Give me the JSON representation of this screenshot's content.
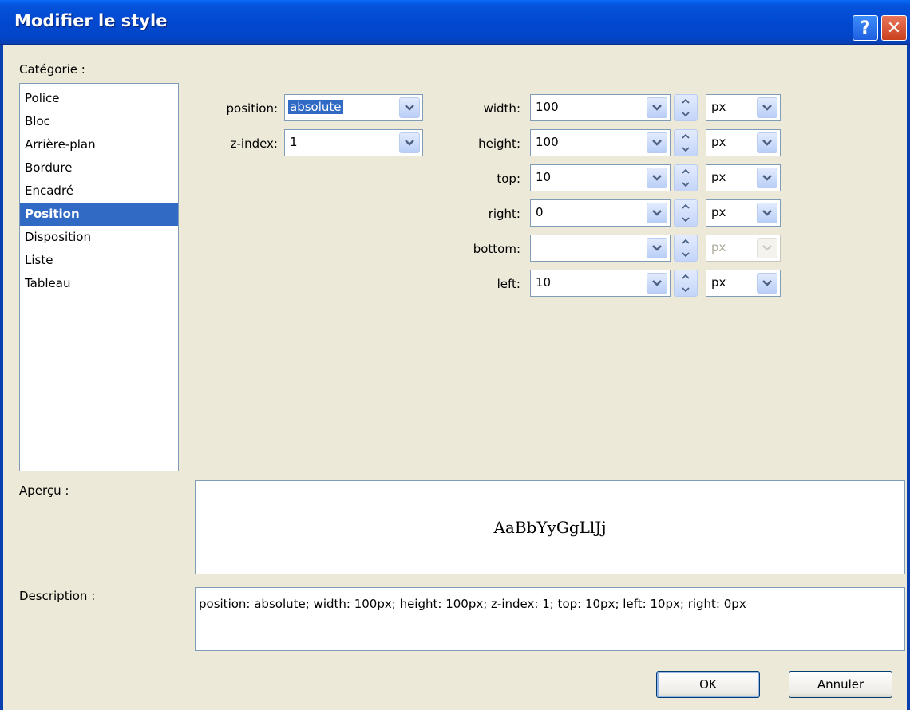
{
  "window": {
    "title": "Modifier le style"
  },
  "category": {
    "label": "Catégorie :",
    "items": [
      "Police",
      "Bloc",
      "Arrière-plan",
      "Bordure",
      "Encadré",
      "Position",
      "Disposition",
      "Liste",
      "Tableau"
    ],
    "selected": "Position"
  },
  "position_panel": {
    "position_label": "position:",
    "position_value": "absolute",
    "zindex_label": "z-index:",
    "zindex_value": "1",
    "width_label": "width:",
    "width_value": "100",
    "width_unit": "px",
    "height_label": "height:",
    "height_value": "100",
    "height_unit": "px",
    "top_label": "top:",
    "top_value": "10",
    "top_unit": "px",
    "right_label": "right:",
    "right_value": "0",
    "right_unit": "px",
    "bottom_label": "bottom:",
    "bottom_value": "",
    "bottom_unit": "px",
    "left_label": "left:",
    "left_value": "10",
    "left_unit": "px"
  },
  "preview": {
    "label": "Aperçu :",
    "sample": "AaBbYyGgLlJj"
  },
  "description": {
    "label": "Description :",
    "text": "position: absolute; width: 100px; height: 100px; z-index: 1; top: 10px; left: 10px; right: 0px"
  },
  "buttons": {
    "ok": "OK",
    "cancel": "Annuler"
  },
  "icons": {
    "help": "help-icon",
    "close": "close-icon",
    "dropdown": "chevron-down-icon",
    "spin_up": "arrow-up-icon",
    "spin_down": "arrow-down-icon"
  },
  "colors": {
    "titlebar": "#0249D0",
    "selection": "#316AC5",
    "dialog_bg": "#ECE9D8"
  }
}
